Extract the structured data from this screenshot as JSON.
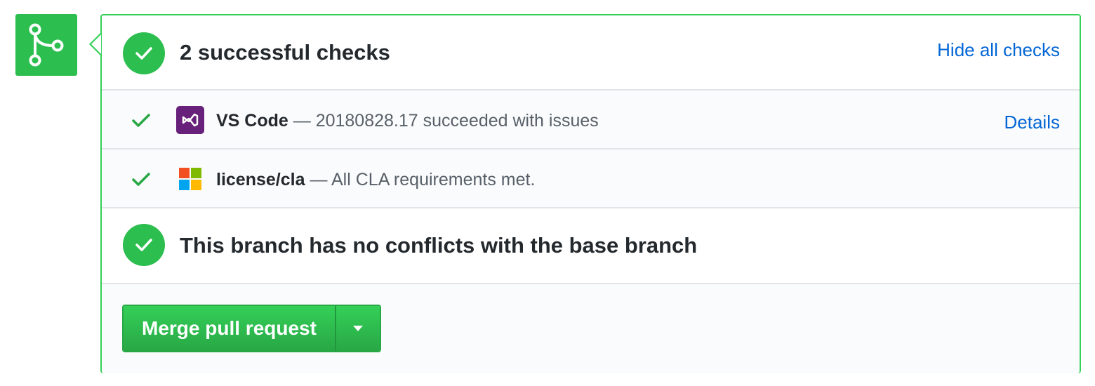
{
  "colors": {
    "success_green": "#2cbe4e",
    "panel_border": "#34d058",
    "link_blue": "#0366d6",
    "vs_purple": "#68217a"
  },
  "merge_icon": {
    "icon": "git-merge-icon"
  },
  "checks_summary": {
    "title": "2 successful checks",
    "toggle_link": "Hide all checks",
    "status_icon": "check-circle-icon"
  },
  "checks": [
    {
      "context": "VS Code",
      "description": "— 20180828.17 succeeded with issues",
      "logo": "visual-studio-logo",
      "details_link": "Details"
    },
    {
      "context": "license/cla",
      "description": "— All CLA requirements met.",
      "logo": "microsoft-logo"
    }
  ],
  "conflicts": {
    "title": "This branch has no conflicts with the base branch",
    "status_icon": "check-circle-icon"
  },
  "merge": {
    "button_label": "Merge pull request",
    "dropdown_icon": "caret-down-icon"
  }
}
